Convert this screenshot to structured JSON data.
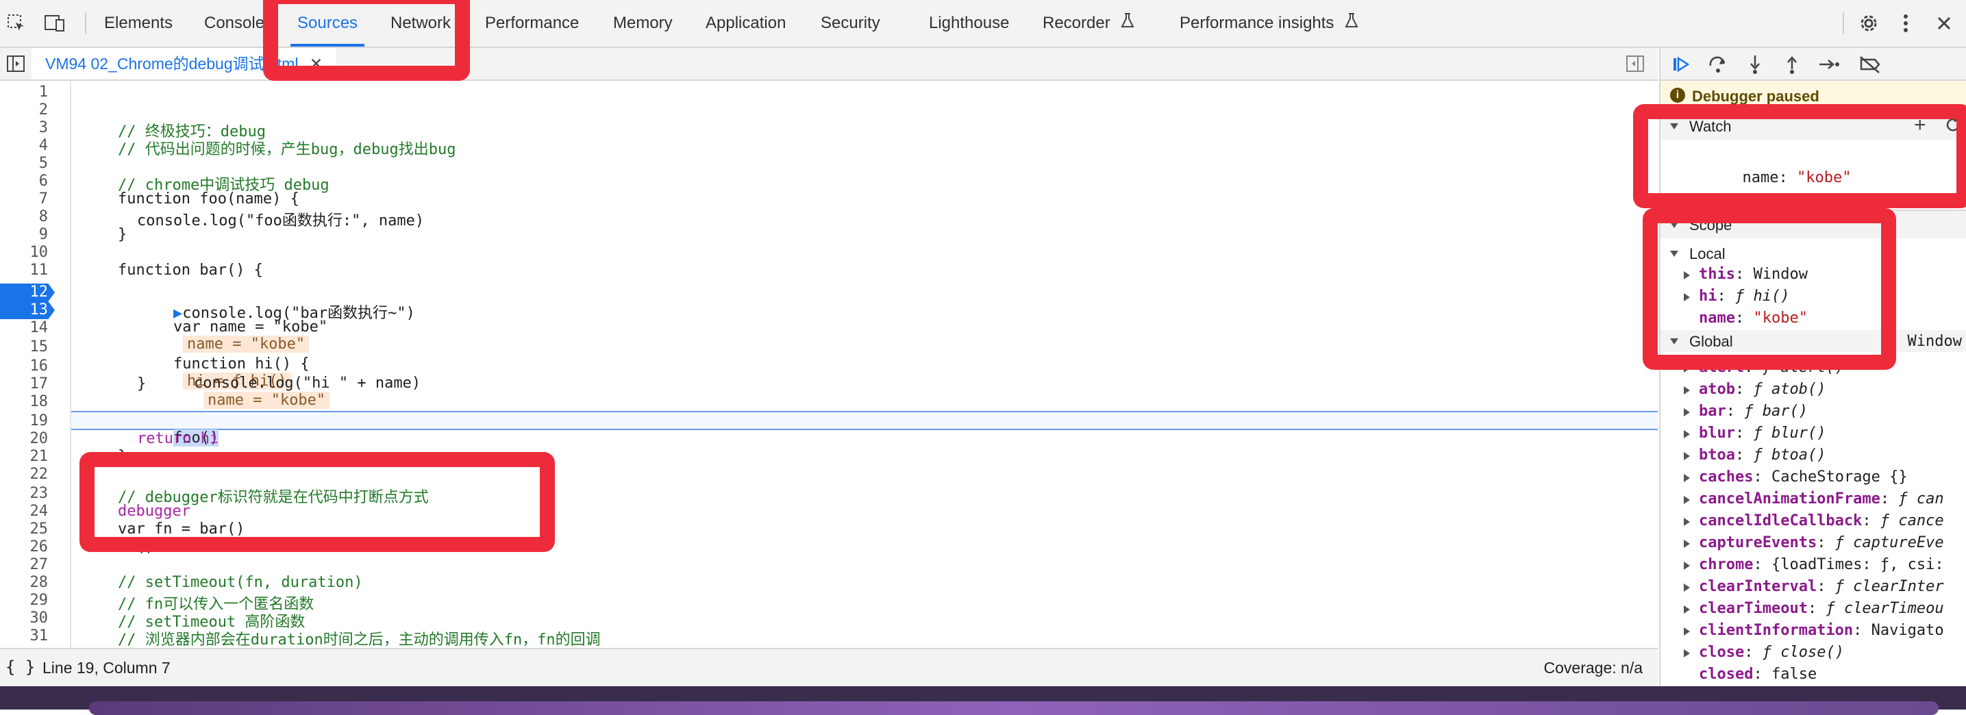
{
  "tabs": [
    "Elements",
    "Console",
    "Sources",
    "Network",
    "Performance",
    "Memory",
    "Application",
    "Security",
    "Lighthouse",
    "Recorder",
    "Performance insights"
  ],
  "active_tab": "Sources",
  "file_tab": "VM94 02_Chrome的debug调试.html",
  "code_lines": [
    {
      "n": "1",
      "t": ""
    },
    {
      "n": "2",
      "t": ""
    },
    {
      "n": "3",
      "t": "// 终极技巧：debug"
    },
    {
      "n": "4",
      "t": "// 代码出问题的时候，产生bug，debug找出bug"
    },
    {
      "n": "5",
      "t": ""
    },
    {
      "n": "6",
      "t": "// chrome中调试技巧 debug"
    },
    {
      "n": "7",
      "t": "function foo(name) {"
    },
    {
      "n": "8",
      "t": "console.log(\"foo函数执行:\", name)"
    },
    {
      "n": "9",
      "t": "}"
    },
    {
      "n": "10",
      "t": ""
    },
    {
      "n": "11",
      "t": "function bar() {"
    },
    {
      "n": "12",
      "t": "console.log(\"bar函数执行~\")"
    },
    {
      "n": "13",
      "t": "var name = \"kobe\""
    },
    {
      "n": "14",
      "t": ""
    },
    {
      "n": "15",
      "t": "function hi() {"
    },
    {
      "n": "16",
      "t": "console.log(\"hi \" + name)"
    },
    {
      "n": "17",
      "t": "}"
    },
    {
      "n": "18",
      "t": ""
    },
    {
      "n": "19",
      "t": "foo()"
    },
    {
      "n": "20",
      "t": "return hi"
    },
    {
      "n": "21",
      "t": "}"
    },
    {
      "n": "22",
      "t": ""
    },
    {
      "n": "23",
      "t": "// debugger标识符就是在代码中打断点方式"
    },
    {
      "n": "24",
      "t": "debugger"
    },
    {
      "n": "25",
      "t": "var fn = bar()"
    },
    {
      "n": "26",
      "t": "fn()"
    },
    {
      "n": "27",
      "t": ""
    },
    {
      "n": "28",
      "t": "// setTimeout(fn, duration)"
    },
    {
      "n": "29",
      "t": "// fn可以传入一个匿名函数"
    },
    {
      "n": "30",
      "t": "// setTimeout 高阶函数"
    },
    {
      "n": "31",
      "t": "// 浏览器内部会在duration时间之后，主动的调用传入fn，fn的回调"
    }
  ],
  "inline_values": {
    "line13": "name = \"kobe\"",
    "line15": "hi = ƒ hi()",
    "line16": "name = \"kobe\""
  },
  "status": {
    "position": "Line 19, Column 7",
    "coverage": "Coverage: n/a",
    "format_icon": "{ }"
  },
  "debugger": {
    "paused": "Debugger paused",
    "watch_title": "Watch",
    "watch_items": [
      {
        "name": "name",
        "value": "\"kobe\""
      }
    ],
    "scope_title": "Scope",
    "local_title": "Local",
    "local_items": [
      {
        "name": "this",
        "value": "Window"
      },
      {
        "name": "hi",
        "value": "ƒ hi()"
      },
      {
        "name": "name",
        "value": "\"kobe\""
      }
    ],
    "global_title": "Global",
    "global_value": "Window",
    "global_items": [
      {
        "name": "alert",
        "value": "ƒ alert()"
      },
      {
        "name": "atob",
        "value": "ƒ atob()"
      },
      {
        "name": "bar",
        "value": "ƒ bar()"
      },
      {
        "name": "blur",
        "value": "ƒ blur()"
      },
      {
        "name": "btoa",
        "value": "ƒ btoa()"
      },
      {
        "name": "caches",
        "value": "CacheStorage {}"
      },
      {
        "name": "cancelAnimationFrame",
        "value": "ƒ can"
      },
      {
        "name": "cancelIdleCallback",
        "value": "ƒ cance"
      },
      {
        "name": "captureEvents",
        "value": "ƒ captureEve"
      },
      {
        "name": "chrome",
        "value": "{loadTimes: ƒ, csi:"
      },
      {
        "name": "clearInterval",
        "value": "ƒ clearInter"
      },
      {
        "name": "clearTimeout",
        "value": "ƒ clearTimeou"
      },
      {
        "name": "clientInformation",
        "value": "Navigato"
      },
      {
        "name": "close",
        "value": "ƒ close()"
      },
      {
        "name": "closed",
        "value": "false"
      }
    ]
  },
  "icons": [
    "inspect-icon",
    "device-toolbar-icon",
    "flask-icon",
    "settings-icon",
    "kebab-menu-icon",
    "sidebar-toggle-icon",
    "resume-icon",
    "step-over-icon",
    "step-into-icon",
    "step-out-icon",
    "step-icon",
    "deactivate-breakpoints-icon",
    "add-icon",
    "refresh-icon",
    "info-icon"
  ],
  "colors": {
    "accent": "#1a73e8",
    "annotation": "#ee2b3a",
    "comment": "#237a28",
    "keyword": "#a626a4",
    "string": "#b71c1c"
  }
}
